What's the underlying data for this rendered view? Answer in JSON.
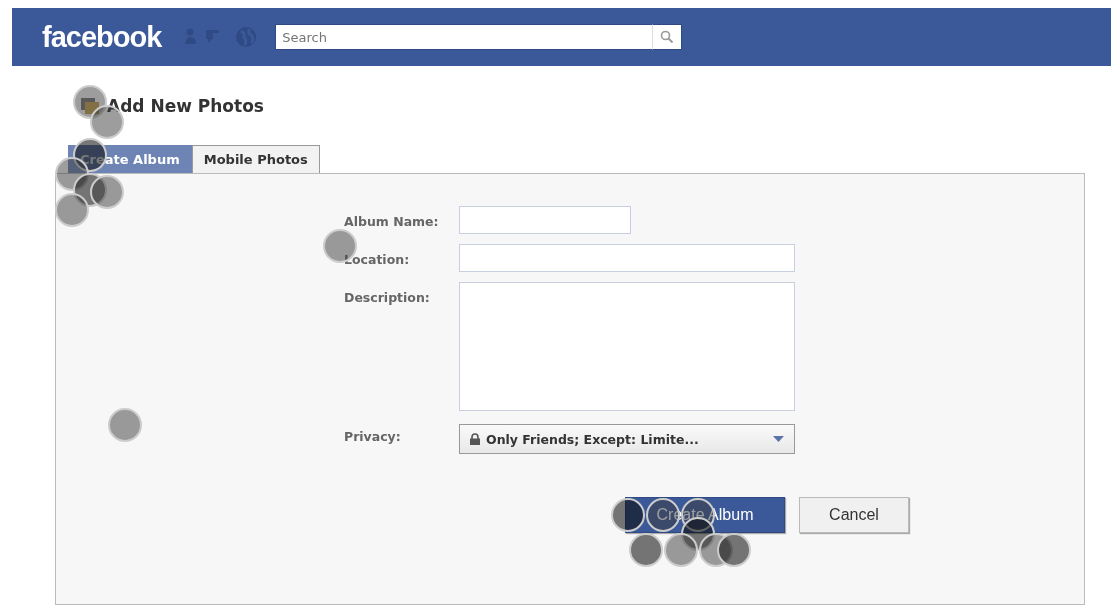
{
  "header": {
    "logo": "facebook",
    "search": {
      "placeholder": "Search"
    }
  },
  "page_title": "Add New Photos",
  "tabs": [
    {
      "label": "Create Album",
      "selected": true
    },
    {
      "label": "Mobile Photos",
      "selected": false
    }
  ],
  "form": {
    "fields": [
      {
        "label": "Album Name:",
        "kind": "short"
      },
      {
        "label": "Location:",
        "kind": "text"
      },
      {
        "label": "Description:",
        "kind": "textarea"
      },
      {
        "label": "Privacy:",
        "kind": "select",
        "value": "Only Friends; Except: Limite..."
      }
    ],
    "buttons": [
      {
        "label": "Create Album",
        "kind": "primary"
      },
      {
        "label": "Cancel",
        "kind": "secondary"
      }
    ]
  }
}
